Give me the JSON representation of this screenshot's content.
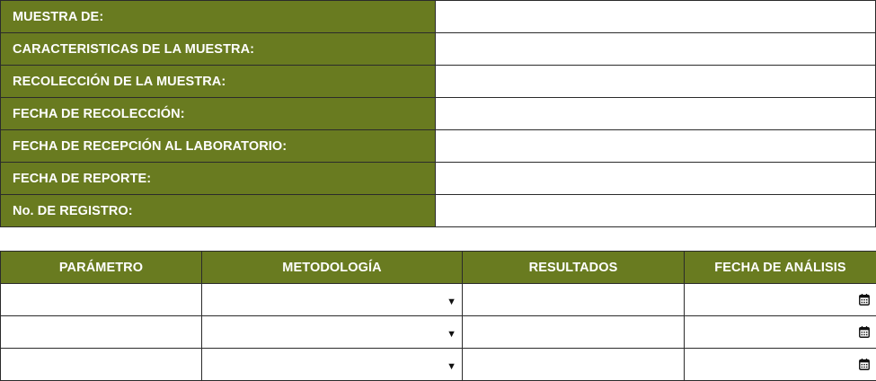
{
  "sample_info": {
    "fields": [
      {
        "label": "MUESTRA DE:",
        "value": ""
      },
      {
        "label": "CARACTERISTICAS DE LA MUESTRA:",
        "value": ""
      },
      {
        "label": "RECOLECCIÓN DE LA MUESTRA:",
        "value": ""
      },
      {
        "label": "FECHA DE RECOLECCIÓN:",
        "value": ""
      },
      {
        "label": "FECHA DE RECEPCIÓN AL LABORATORIO:",
        "value": ""
      },
      {
        "label": "FECHA DE REPORTE:",
        "value": ""
      },
      {
        "label": "No. DE REGISTRO:",
        "value": ""
      }
    ]
  },
  "parameters_table": {
    "headers": [
      "PARÁMETRO",
      "METODOLOGÍA",
      "RESULTADOS",
      "FECHA DE ANÁLISIS"
    ],
    "rows": [
      {
        "parametro": "",
        "metodologia": "",
        "resultados": "",
        "fecha_analisis": ""
      },
      {
        "parametro": "",
        "metodologia": "",
        "resultados": "",
        "fecha_analisis": ""
      },
      {
        "parametro": "",
        "metodologia": "",
        "resultados": "",
        "fecha_analisis": ""
      }
    ],
    "icons": {
      "dropdown": "dropdown-arrow-icon",
      "date": "calendar-icon"
    }
  },
  "colors": {
    "header_bg": "#697b20",
    "header_text": "#ffffff",
    "border": "#2b2b2b"
  }
}
